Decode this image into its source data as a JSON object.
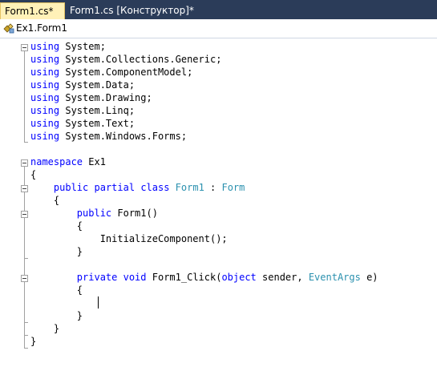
{
  "tabs": [
    {
      "label": "Form1.cs*",
      "active": true
    },
    {
      "label": "Form1.cs [Конструктор]*",
      "active": false
    }
  ],
  "nav": {
    "class_name": "Ex1.Form1",
    "icon": "class-icon"
  },
  "code": {
    "l1": [
      "using",
      " System;"
    ],
    "l2": [
      "using",
      " System.Collections.Generic;"
    ],
    "l3": [
      "using",
      " System.ComponentModel;"
    ],
    "l4": [
      "using",
      " System.Data;"
    ],
    "l5": [
      "using",
      " System.Drawing;"
    ],
    "l6": [
      "using",
      " System.Linq;"
    ],
    "l7": [
      "using",
      " System.Text;"
    ],
    "l8": [
      "using",
      " System.Windows.Forms;"
    ],
    "l10": [
      "namespace",
      " Ex1"
    ],
    "l11": "{",
    "l12": [
      "    ",
      "public",
      " ",
      "partial",
      " ",
      "class",
      " ",
      "Form1",
      " : ",
      "Form"
    ],
    "l13": "    {",
    "l14": [
      "        ",
      "public",
      " Form1()"
    ],
    "l15": "        {",
    "l16": "            InitializeComponent();",
    "l17": "        }",
    "l19": [
      "        ",
      "private",
      " ",
      "void",
      " Form1_Click(",
      "object",
      " sender, ",
      "EventArgs",
      " e)"
    ],
    "l20": "        {",
    "l22": "        }",
    "l23": "    }",
    "l24": "}"
  },
  "colors": {
    "keyword": "#0000ff",
    "type": "#2b91af",
    "tab_active_bg": "#fff1b8",
    "tabbar_bg": "#2b3c59"
  }
}
